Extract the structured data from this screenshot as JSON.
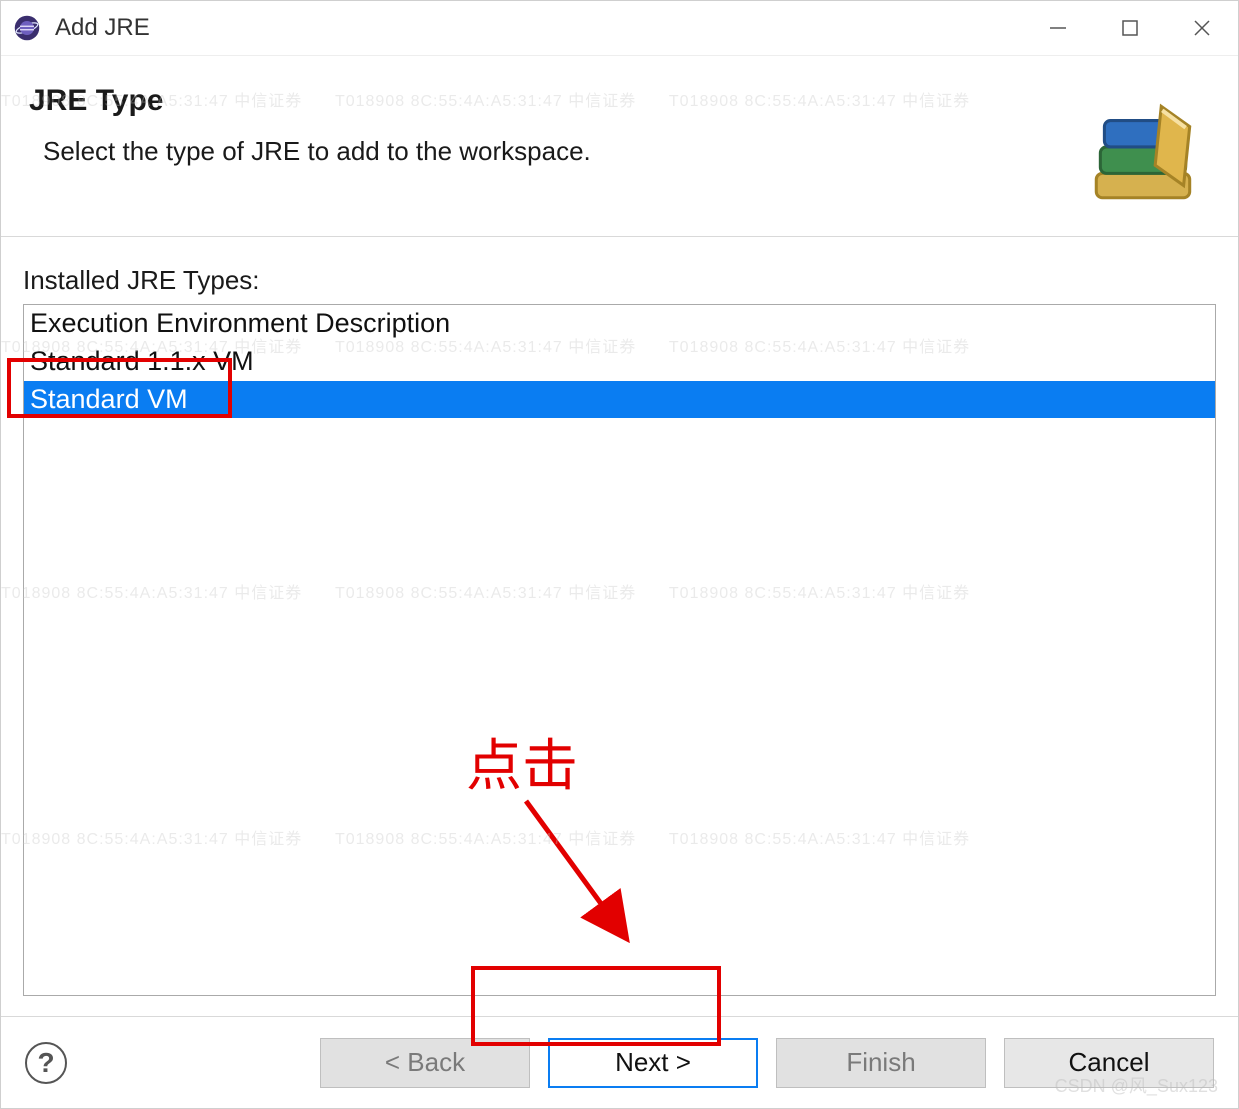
{
  "window": {
    "title": "Add JRE"
  },
  "header": {
    "heading": "JRE Type",
    "description": "Select the type of JRE to add to the workspace."
  },
  "list": {
    "label": "Installed JRE Types:",
    "items": [
      {
        "label": "Execution Environment Description",
        "selected": false
      },
      {
        "label": "Standard 1.1.x VM",
        "selected": false
      },
      {
        "label": "Standard VM",
        "selected": true
      }
    ]
  },
  "buttons": {
    "back": "< Back",
    "next": "Next >",
    "finish": "Finish",
    "cancel": "Cancel",
    "help_glyph": "?"
  },
  "annotations": {
    "click_label": "点击"
  },
  "watermark_repeat": "T018908  8C:55:4A:A5:31:47   中信证券",
  "corner_watermark": "CSDN @风_Sux123"
}
